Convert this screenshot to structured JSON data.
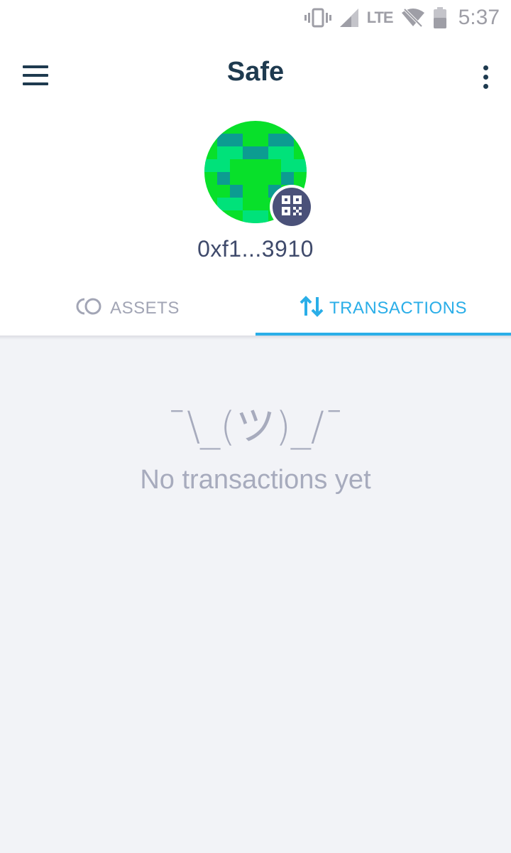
{
  "status_bar": {
    "time": "5:37",
    "network": "LTE",
    "icons": [
      "vibrate-icon",
      "signal-icon",
      "wifi-off-icon",
      "battery-icon"
    ]
  },
  "toolbar": {
    "title": "Safe",
    "menu_icon": "hamburger-menu-icon",
    "more_icon": "more-vertical-icon"
  },
  "safe": {
    "address": "0xf1...3910",
    "qr_icon": "qr-code-icon"
  },
  "tabs": [
    {
      "label": "ASSETS",
      "icon": "assets-coins-icon",
      "selected": false
    },
    {
      "label": "TRANSACTIONS",
      "icon": "transfer-arrows-icon",
      "selected": true
    }
  ],
  "empty_state": {
    "face": "¯\\_(ツ)_/¯",
    "message": "No transactions yet"
  },
  "colors": {
    "primary_text": "#1e3a4f",
    "accent": "#2aaee8",
    "muted": "#a2a5b5",
    "background": "#f2f3f7",
    "avatar_green": "#08e02a",
    "avatar_light": "#00e27a",
    "avatar_teal": "#0c9c91"
  }
}
